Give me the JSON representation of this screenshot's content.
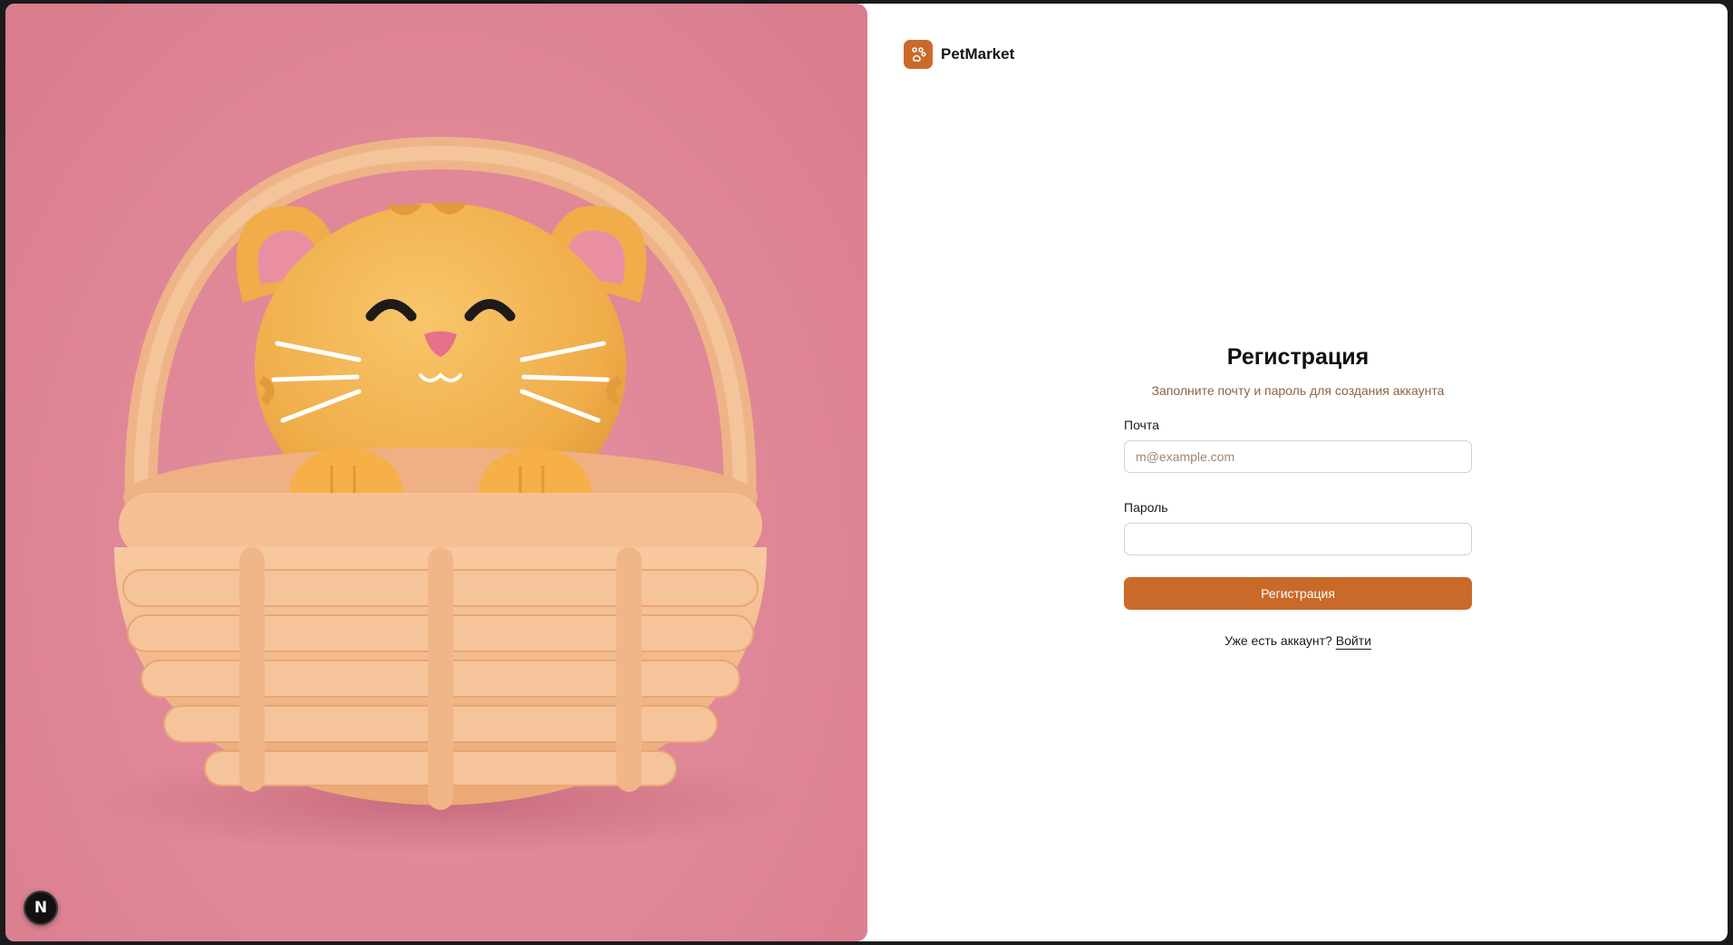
{
  "brand": {
    "name": "PetMarket",
    "logo_icon": "paw-icon",
    "accent": "#c96a2a"
  },
  "form": {
    "title": "Регистрация",
    "subtitle": "Заполните почту и пароль для создания аккаунта",
    "email_label": "Почта",
    "email_placeholder": "m@example.com",
    "email_value": "",
    "password_label": "Пароль",
    "password_value": "",
    "submit_label": "Регистрация",
    "login_prompt": "Уже есть аккаунт?",
    "login_link": "Войти"
  },
  "badge": {
    "label": "N"
  },
  "colors": {
    "hero_background": "#df8797",
    "submit_button": "#c96a2a"
  }
}
